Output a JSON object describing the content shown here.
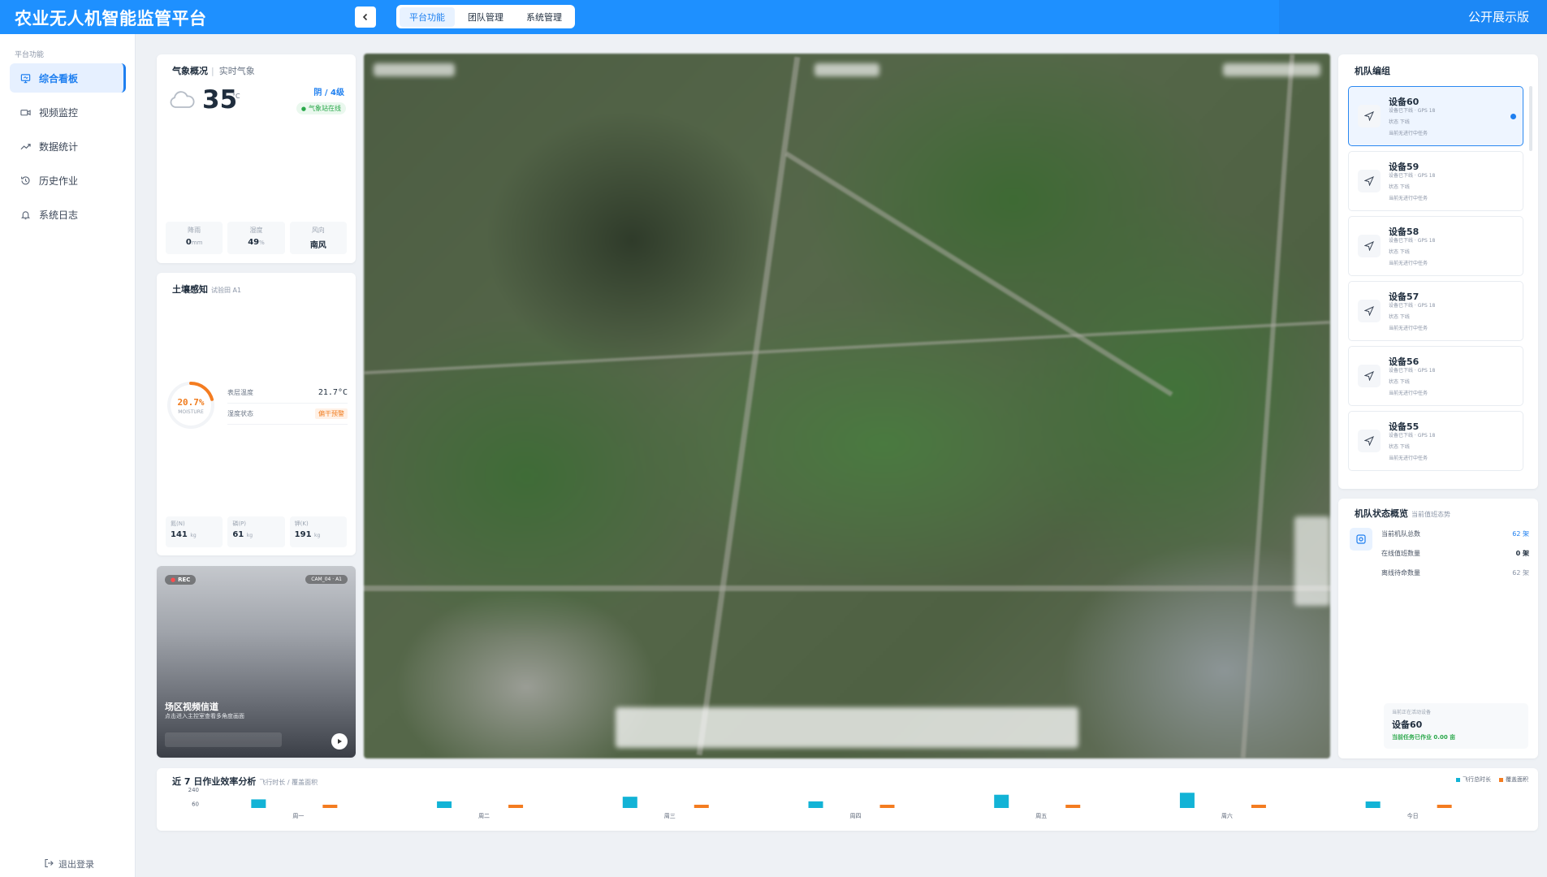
{
  "header": {
    "title": "农业无人机智能监管平台",
    "back_icon": "chevron-left-icon",
    "tabs": [
      {
        "label": "平台功能",
        "active": true
      },
      {
        "label": "团队管理",
        "active": false
      },
      {
        "label": "系统管理",
        "active": false
      }
    ],
    "right_text": "公开展示版",
    "accent_color": "#1e90ff"
  },
  "sidebar": {
    "section_label": "平台功能",
    "items": [
      {
        "label": "综合看板",
        "icon": "monitor-icon",
        "active": true
      },
      {
        "label": "视频监控",
        "icon": "video-icon",
        "active": false
      },
      {
        "label": "数据统计",
        "icon": "trend-icon",
        "active": false
      },
      {
        "label": "历史作业",
        "icon": "history-icon",
        "active": false
      },
      {
        "label": "系统日志",
        "icon": "bell-icon",
        "active": false
      }
    ],
    "logout_label": "退出登录"
  },
  "weather": {
    "title": "气象概况",
    "subtitle": "实时气象",
    "temperature": "35",
    "unit": "°C",
    "condition": "阴 / 4级",
    "station_status": "气象站在线",
    "stats": [
      {
        "label": "降雨",
        "value": "0",
        "unit": "mm"
      },
      {
        "label": "湿度",
        "value": "49",
        "unit": "%"
      },
      {
        "label": "风向",
        "value": "南风",
        "unit": ""
      }
    ]
  },
  "soil": {
    "title": "土壤感知",
    "field": "试验田 A1",
    "moisture": "20.7%",
    "moisture_fraction": 0.207,
    "moisture_label": "MOISTURE",
    "rows": [
      {
        "label": "表层温度",
        "value": "21.7°C"
      },
      {
        "label": "湿度状态",
        "value": "偏干预警"
      }
    ],
    "npk": [
      {
        "label": "氮(N)",
        "value": "141",
        "unit": "kg"
      },
      {
        "label": "磷(P)",
        "value": "61",
        "unit": "kg"
      },
      {
        "label": "钾(K)",
        "value": "191",
        "unit": "kg"
      }
    ]
  },
  "video": {
    "rec_label": "REC",
    "camera_label": "CAM_04 · A1",
    "title": "场区视频信道",
    "subtitle": "点击进入主控室查看多角度画面"
  },
  "fleet": {
    "title": "机队编组",
    "devices": [
      {
        "name": "设备60",
        "line1": "设备已下线 · GPS 18",
        "line2": "状态 下线",
        "line3": "当前无进行中任务",
        "active": true
      },
      {
        "name": "设备59",
        "line1": "设备已下线 · GPS 18",
        "line2": "状态 下线",
        "line3": "当前无进行中任务",
        "active": false
      },
      {
        "name": "设备58",
        "line1": "设备已下线 · GPS 18",
        "line2": "状态 下线",
        "line3": "当前无进行中任务",
        "active": false
      },
      {
        "name": "设备57",
        "line1": "设备已下线 · GPS 18",
        "line2": "状态 下线",
        "line3": "当前无进行中任务",
        "active": false
      },
      {
        "name": "设备56",
        "line1": "设备已下线 · GPS 18",
        "line2": "状态 下线",
        "line3": "当前无进行中任务",
        "active": false
      },
      {
        "name": "设备55",
        "line1": "设备已下线 · GPS 18",
        "line2": "状态 下线",
        "line3": "当前无进行中任务",
        "active": false
      }
    ]
  },
  "fleet_status": {
    "title": "机队状态概览",
    "subtitle": "当前值班态势",
    "rows": [
      {
        "label": "当前机队总数",
        "value": "62 架"
      },
      {
        "label": "在线值班数量",
        "value": "0 架"
      },
      {
        "label": "离线待命数量",
        "value": "62 架"
      }
    ],
    "current_label": "当前正在活动设备",
    "current_device": "设备60",
    "current_status": "当前任务已作业 0.00 亩"
  },
  "efficiency": {
    "title": "近 7 日作业效率分析",
    "subtitle": "飞行时长 / 覆盖面积",
    "legend": [
      {
        "label": "飞行总时长",
        "color": "#12b3d6"
      },
      {
        "label": "覆盖面积",
        "color": "#f47c20"
      }
    ],
    "y_ticks": [
      "240",
      "60"
    ]
  },
  "chart_data": {
    "type": "bar",
    "title": "近 7 日作业效率分析",
    "categories": [
      "周一",
      "周二",
      "周三",
      "周四",
      "周五",
      "周六",
      "今日"
    ],
    "series": [
      {
        "name": "飞行总时长",
        "color": "#12b3d6",
        "values": [
          130,
          100,
          170,
          100,
          200,
          230,
          60
        ]
      },
      {
        "name": "覆盖面积",
        "color": "#f47c20",
        "values": [
          50,
          30,
          70,
          40,
          80,
          100,
          20
        ]
      }
    ],
    "ylim": [
      0,
      240
    ],
    "y_ticks": [
      240,
      60
    ]
  }
}
